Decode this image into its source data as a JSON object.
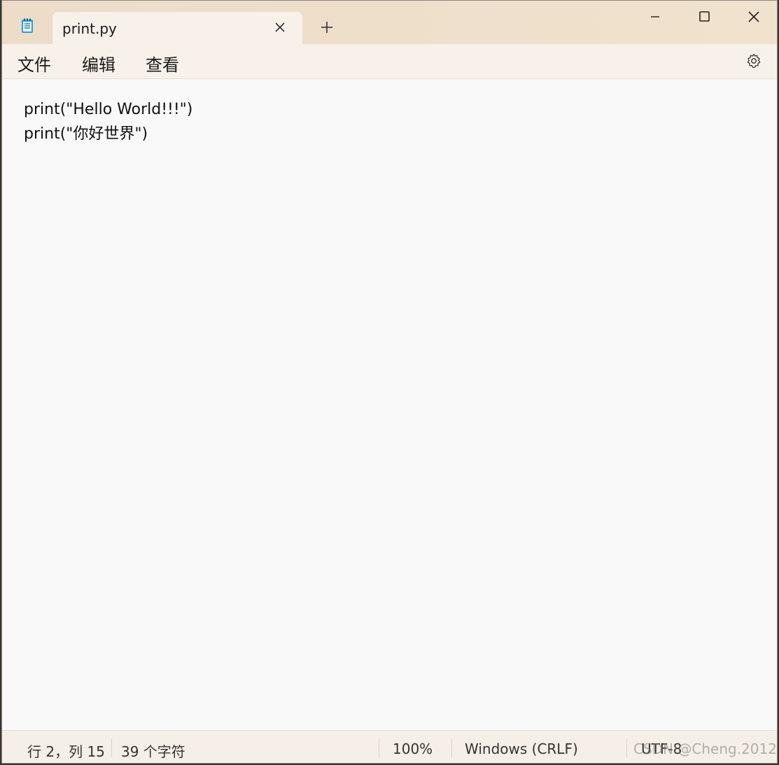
{
  "tab": {
    "title": "print.py"
  },
  "menu": {
    "file": "文件",
    "edit": "编辑",
    "view": "查看"
  },
  "editor": {
    "lines": [
      "print(\"Hello World!!!\")",
      "print(\"你好世界\")"
    ]
  },
  "status": {
    "position": "行 2，列 15",
    "chars": "39 个字符",
    "zoom": "100%",
    "line_ending": "Windows (CRLF)",
    "encoding": "UTF-8"
  },
  "watermark": "CSDN @Cheng.2012",
  "icons": {
    "app": "notepad-icon",
    "close_tab": "close-icon",
    "new_tab": "plus-icon",
    "minimize": "minimize-icon",
    "maximize": "maximize-icon",
    "close_window": "close-icon",
    "settings": "gear-icon"
  },
  "colors": {
    "titlebar": "#eedfcb",
    "tab_active": "#f7f1ea",
    "editor_bg": "#f9f9f9",
    "accent_icon": "#2a9fd6"
  }
}
